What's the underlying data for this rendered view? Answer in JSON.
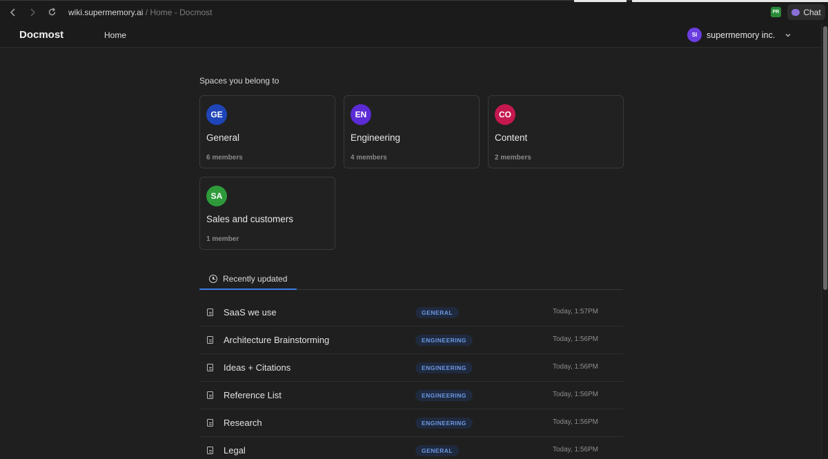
{
  "browser": {
    "url_domain": "wiki.supermemory.ai",
    "url_rest": " / Home - Docmost",
    "extension_badge": "PR",
    "chat_label": "Chat"
  },
  "header": {
    "logo": "Docmost",
    "nav_home": "Home",
    "workspace_initials": "SI",
    "workspace_name": "supermemory inc."
  },
  "spaces": {
    "title": "Spaces you belong to",
    "items": [
      {
        "initials": "GE",
        "name": "General",
        "members": "6 members",
        "color": "#1f45b8"
      },
      {
        "initials": "EN",
        "name": "Engineering",
        "members": "4 members",
        "color": "#5b2bd6"
      },
      {
        "initials": "CO",
        "name": "Content",
        "members": "2 members",
        "color": "#c4184e"
      },
      {
        "initials": "SA",
        "name": "Sales and customers",
        "members": "1 member",
        "color": "#2e9a3a"
      }
    ]
  },
  "recent": {
    "tab_label": "Recently updated",
    "rows": [
      {
        "title": "SaaS we use",
        "space": "GENERAL",
        "time": "Today, 1:57PM"
      },
      {
        "title": "Architecture Brainstorming",
        "space": "ENGINEERING",
        "time": "Today, 1:56PM"
      },
      {
        "title": "Ideas + Citations",
        "space": "ENGINEERING",
        "time": "Today, 1:56PM"
      },
      {
        "title": "Reference List",
        "space": "ENGINEERING",
        "time": "Today, 1:56PM"
      },
      {
        "title": "Research",
        "space": "ENGINEERING",
        "time": "Today, 1:56PM"
      },
      {
        "title": "Legal",
        "space": "GENERAL",
        "time": "Today, 1:56PM"
      }
    ]
  },
  "colors": {
    "accent": "#3d7ce8",
    "badge_text": "#6e9ae6",
    "workspace_avatar": "#6a3de0"
  }
}
